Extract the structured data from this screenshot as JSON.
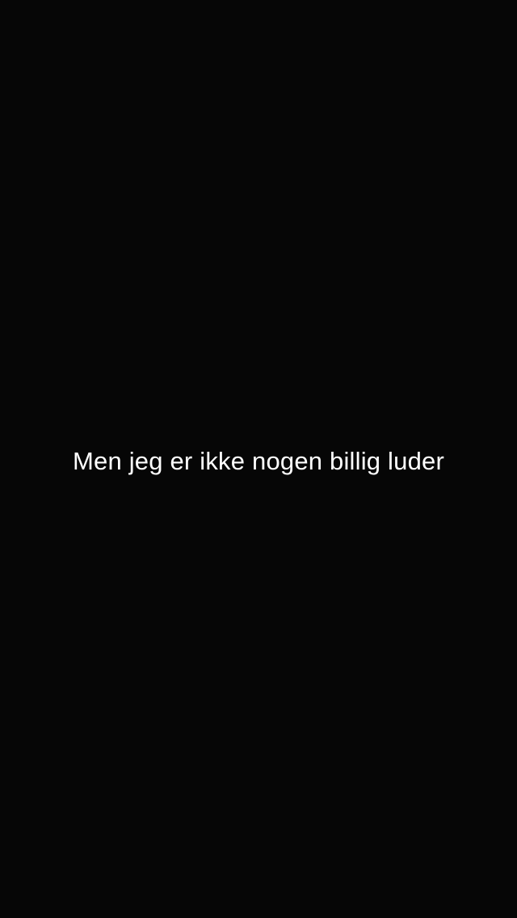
{
  "caption": {
    "text": "Men jeg er ikke nogen billig luder"
  },
  "colors": {
    "background": "#060606",
    "caption_text": "#ffffff"
  }
}
